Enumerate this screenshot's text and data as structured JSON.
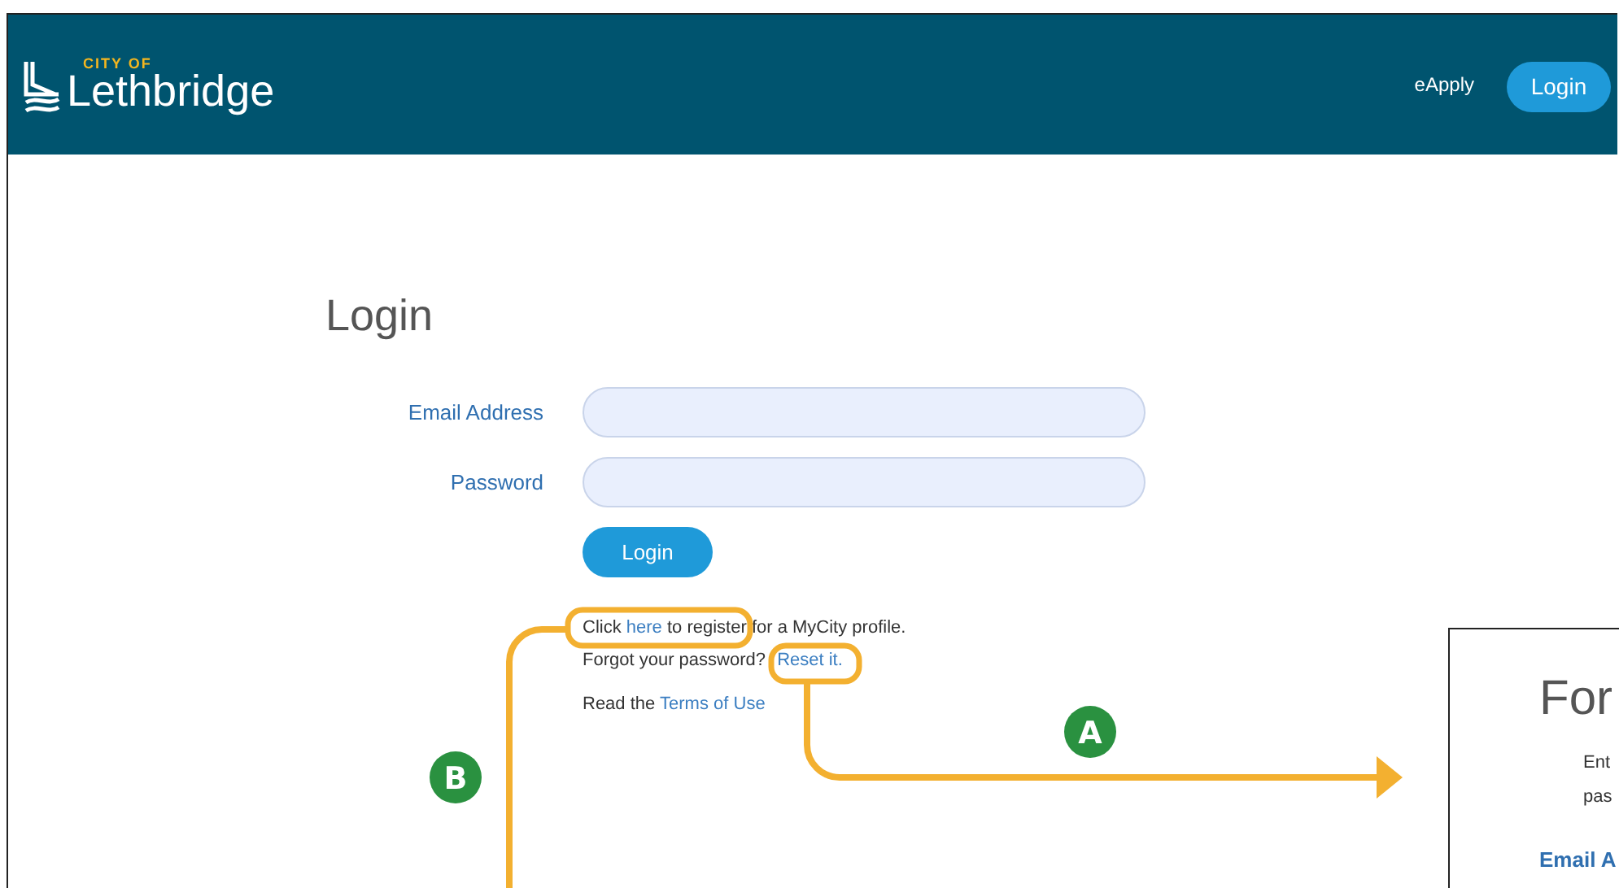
{
  "header": {
    "logo": {
      "tagline": "CITY OF",
      "name": "Lethbridge"
    },
    "nav": [
      {
        "label": "eApply",
        "kind": "link"
      },
      {
        "label": "Login",
        "kind": "button"
      }
    ]
  },
  "login": {
    "title": "Login",
    "fields": [
      {
        "label": "Email Address"
      },
      {
        "label": "Password"
      }
    ],
    "button": "Login",
    "lines": [
      {
        "parts": [
          {
            "kind": "text",
            "text": "Click "
          },
          {
            "kind": "link",
            "text": "here"
          },
          {
            "kind": "text",
            "text": " to register for a MyCity profile."
          }
        ]
      },
      {
        "parts": [
          {
            "kind": "text",
            "text": "Forgot your password? "
          },
          {
            "kind": "link",
            "text": "Reset it."
          }
        ]
      },
      {
        "parts": [
          {
            "kind": "text",
            "text": "Read the "
          },
          {
            "kind": "link",
            "text": "Terms of Use"
          }
        ]
      }
    ]
  },
  "forgot_panel": {
    "title": "For",
    "lines": [
      "Ent",
      "pas"
    ],
    "field_label": "Email A"
  },
  "callouts": [
    {
      "label": "A"
    },
    {
      "label": "B"
    }
  ]
}
